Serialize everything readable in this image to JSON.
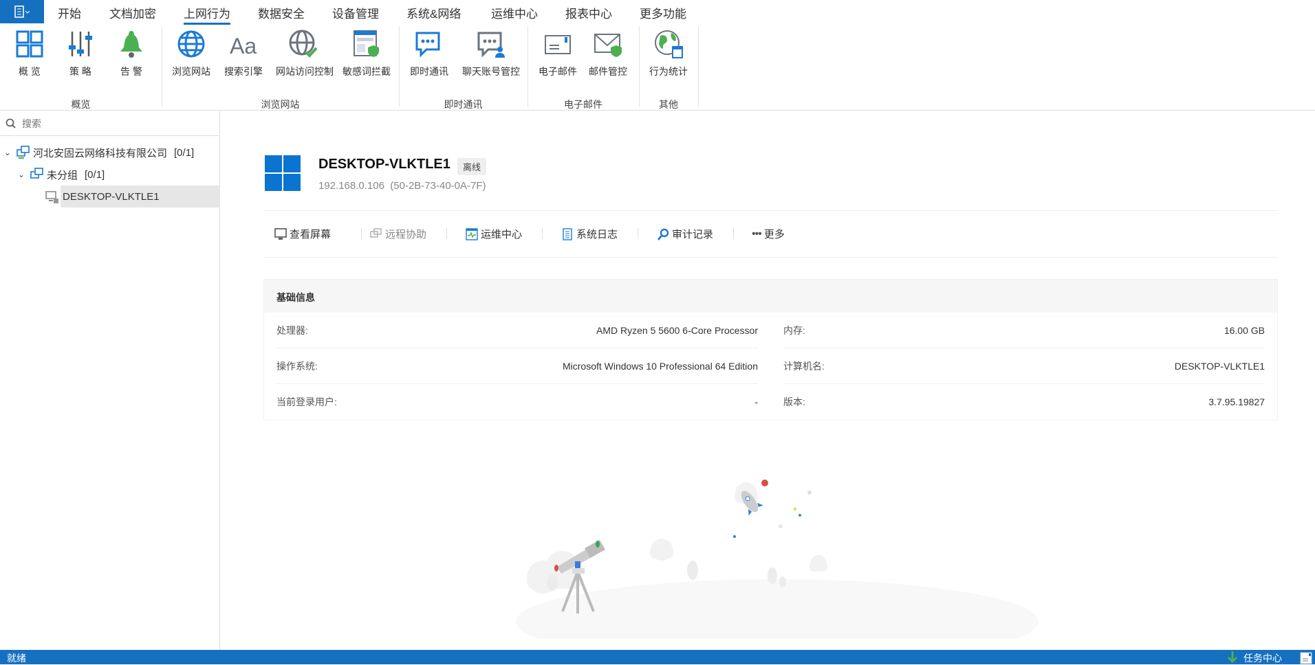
{
  "menubar": {
    "items": [
      "开始",
      "文档加密",
      "上网行为",
      "数据安全",
      "设备管理",
      "系统&网络",
      "运维中心",
      "报表中心",
      "更多功能"
    ],
    "active_index": 2
  },
  "ribbon": {
    "buttons": [
      "概 览",
      "策 略",
      "告 警",
      "浏览网站",
      "搜索引擎",
      "网站访问控制",
      "敏感词拦截",
      "即时通讯",
      "聊天账号管控",
      "电子邮件",
      "邮件管控",
      "行为统计"
    ],
    "groups": [
      "概览",
      "浏览网站",
      "即时通讯",
      "电子邮件",
      "其他"
    ]
  },
  "sidebar": {
    "search_placeholder": "搜索",
    "tree": [
      {
        "label": "河北安固云网络科技有限公司",
        "count": "[0/1]"
      },
      {
        "label": "未分组",
        "count": "[0/1]"
      },
      {
        "label": "DESKTOP-VLKTLE1"
      }
    ]
  },
  "device": {
    "name": "DESKTOP-VLKTLE1",
    "status": "离线",
    "ip": "192.168.0.106",
    "mac": "(50-2B-73-40-0A-7F)"
  },
  "actions": [
    "查看屏幕",
    "远程协助",
    "运维中心",
    "系统日志",
    "审计记录",
    "更多"
  ],
  "info": {
    "title": "基础信息",
    "left": [
      {
        "k": "处理器:",
        "v": "AMD Ryzen 5 5600 6-Core Processor"
      },
      {
        "k": "操作系统:",
        "v": "Microsoft Windows 10 Professional 64 Edition"
      },
      {
        "k": "当前登录用户:",
        "v": "-"
      }
    ],
    "right": [
      {
        "k": "内存:",
        "v": "16.00 GB"
      },
      {
        "k": "计算机名:",
        "v": "DESKTOP-VLKTLE1"
      },
      {
        "k": "版本:",
        "v": "3.7.95.19827"
      }
    ]
  },
  "status": {
    "left": "就绪",
    "task_center": "任务中心"
  },
  "colors": {
    "accent": "#1570c0",
    "green": "#4caf50"
  }
}
